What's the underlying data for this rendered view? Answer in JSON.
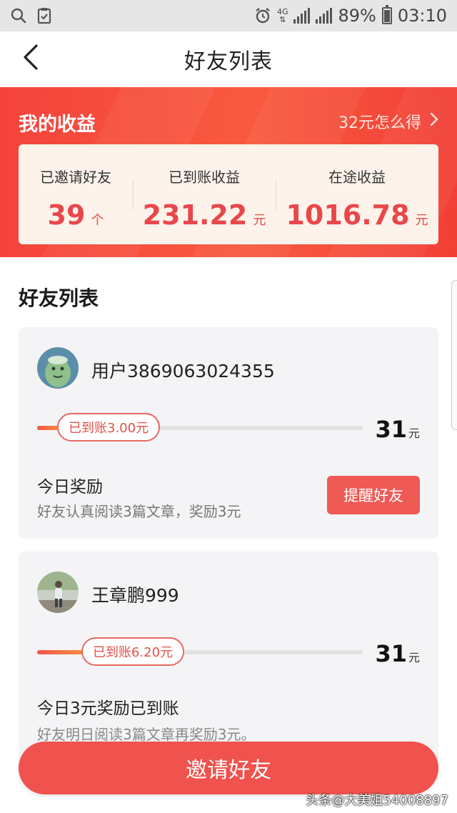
{
  "status_bar": {
    "network": "4G",
    "battery": "89%",
    "time": "03:10",
    "icons": [
      "search-icon",
      "clipboard-check-icon",
      "alarm-icon",
      "signal-icon",
      "battery-icon"
    ]
  },
  "nav": {
    "title": "好友列表",
    "back_icon": "chevron-left-icon"
  },
  "earnings": {
    "title": "我的收益",
    "link_label": "32元怎么得",
    "stats": [
      {
        "label": "已邀请好友",
        "value": "39",
        "unit": "个"
      },
      {
        "label": "已到账收益",
        "value": "231.22",
        "unit": "元"
      },
      {
        "label": "在途收益",
        "value": "1016.78",
        "unit": "元"
      }
    ],
    "colors": {
      "banner": "#f4433b",
      "value": "#e8484b",
      "card": "#fdf3ea"
    }
  },
  "friends_section": {
    "title": "好友列表",
    "friends": [
      {
        "name": "用户3869063024355",
        "avatar": "green-frog-avatar",
        "progress_label": "已到账3.00元",
        "progress_fraction": 0.097,
        "reward_value": "31",
        "reward_unit": "元",
        "today_title": "今日奖励",
        "today_desc": "好友认真阅读3篇文章，奖励3元",
        "action_label": "提醒好友"
      },
      {
        "name": "王章鹏999",
        "avatar": "photo-person-avatar",
        "progress_label": "已到账6.20元",
        "progress_fraction": 0.2,
        "reward_value": "31",
        "reward_unit": "元",
        "today_title": "今日3元奖励已到账",
        "today_desc": "好友明日阅读3篇文章再奖励3元。"
      }
    ]
  },
  "invite_button": {
    "label": "邀请好友"
  },
  "watermark": "头条@大美姐54008897"
}
